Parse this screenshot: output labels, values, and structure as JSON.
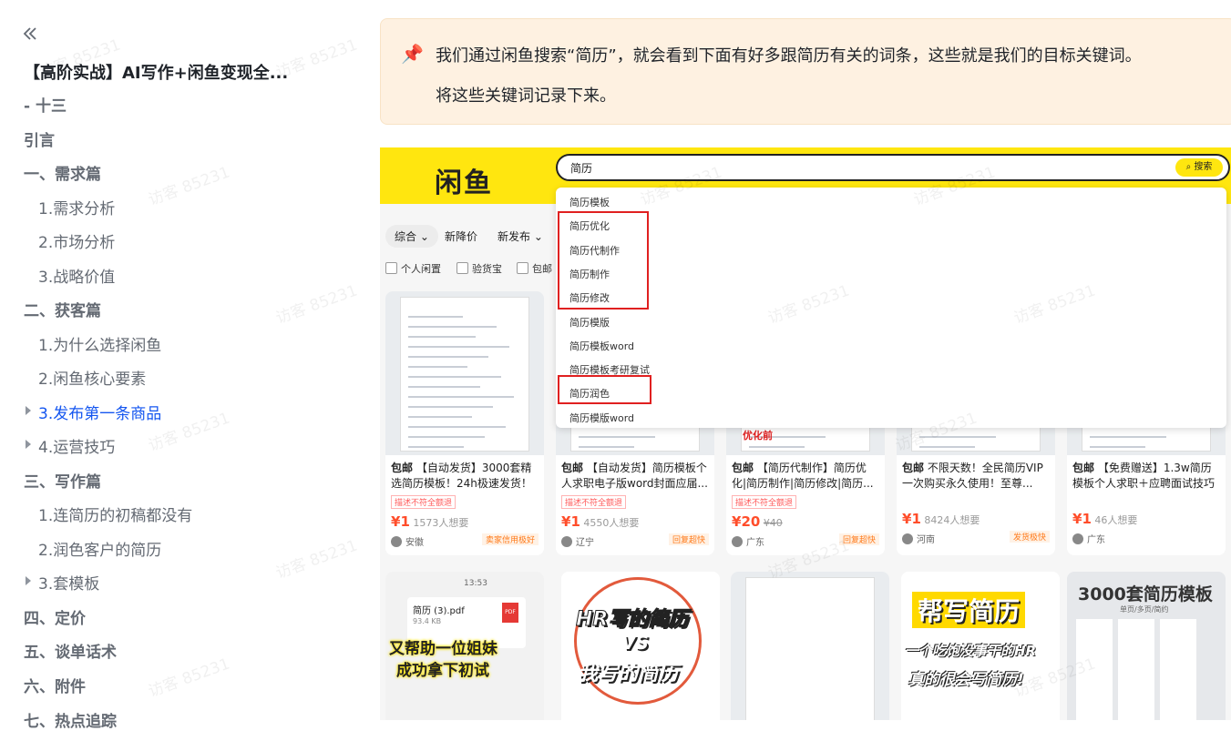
{
  "sidebar": {
    "title": "【高阶实战】AI写作+闲鱼变现全...",
    "items": [
      {
        "label": "- 十三",
        "level": "h"
      },
      {
        "label": "引言",
        "level": "h"
      },
      {
        "label": "一、需求篇",
        "level": "h"
      },
      {
        "label": "1.需求分析",
        "level": "sub"
      },
      {
        "label": "2.市场分析",
        "level": "sub"
      },
      {
        "label": "3.战略价值",
        "level": "sub"
      },
      {
        "label": "二、获客篇",
        "level": "h"
      },
      {
        "label": "1.为什么选择闲鱼",
        "level": "sub"
      },
      {
        "label": "2.闲鱼核心要素",
        "level": "sub"
      },
      {
        "label": "3.发布第一条商品",
        "level": "sub",
        "active": true,
        "caret": true
      },
      {
        "label": "4.运营技巧",
        "level": "sub",
        "caret": true
      },
      {
        "label": "三、写作篇",
        "level": "h"
      },
      {
        "label": "1.连简历的初稿都没有",
        "level": "sub"
      },
      {
        "label": "2.润色客户的简历",
        "level": "sub"
      },
      {
        "label": "3.套模板",
        "level": "sub",
        "caret": true
      },
      {
        "label": "四、定价",
        "level": "h"
      },
      {
        "label": "五、谈单话术",
        "level": "h"
      },
      {
        "label": "六、附件",
        "level": "h"
      },
      {
        "label": "七、热点追踪",
        "level": "h"
      }
    ]
  },
  "callout": {
    "icon": "pushpin-icon",
    "line1": "我们通过闲鱼搜索“简历”，就会看到下面有好多跟简历有关的词条，这些就是我们的目标关键词。",
    "line2": "将这些关键词记录下来。"
  },
  "screenshot": {
    "logo": "闲鱼",
    "search_value": "简历",
    "search_button": "搜索",
    "suggestions": [
      "简历模板",
      "简历优化",
      "简历代制作",
      "简历制作",
      "简历修改",
      "简历模版",
      "简历模板word",
      "简历模板考研复试",
      "简历润色",
      "简历模版word"
    ],
    "tabs": [
      "综合",
      "新降价",
      "新发布"
    ],
    "checks": [
      "个人闲置",
      "验货宝",
      "包邮"
    ],
    "cards": [
      {
        "tag": "包邮",
        "title": "【自动发货】3000套精选简历模板！24h极速发货！附...",
        "badge": "描述不符全额退",
        "price": "1",
        "want": "1573人想要",
        "region": "安徽",
        "seller_tag": "卖家信用极好"
      },
      {
        "tag": "包邮",
        "title": "【自动发货】简历模板个人求职电子版word封面应届...",
        "badge": "描述不符全额退",
        "price": "1",
        "want": "4550人想要",
        "region": "辽宁",
        "seller_tag": "回复超快"
      },
      {
        "tag": "包邮",
        "title": "【简历代制作】简历优化|简历制作|简历修改|简历...",
        "badge": "描述不符全额退",
        "price": "20",
        "old_price": "¥40",
        "want": "",
        "region": "广东",
        "seller_tag": "回复超快",
        "overlay": "优化前"
      },
      {
        "tag": "包邮",
        "title": "不限天数！全民简历VIP一次购买永久使用！至尊...",
        "badge": "",
        "price": "1",
        "want": "8424人想要",
        "region": "河南",
        "seller_tag": "发货极快"
      },
      {
        "tag": "包邮",
        "title": "【免费赠送】1.3w简历模板个人求职＋应聘面试技巧＋...",
        "badge": "",
        "price": "1",
        "want": "46人想要",
        "region": "广东",
        "seller_tag": ""
      }
    ],
    "row2": {
      "c1_file": "简历 (3).pdf",
      "c1_size": "93.4 KB",
      "c1_time": "13:53",
      "c1_text1": "又帮助一位姐妹",
      "c1_text2": "成功拿下初试",
      "c2_text1": "HR写的简历",
      "c2_text2": "VS",
      "c2_text3": "我写的简历",
      "c4_text1": "帮写简历",
      "c4_text2": "一个吃饱没事干的HR",
      "c4_text3": "真的很会写简历!",
      "c5_text1": "3000套简历模板",
      "c5_text2": "单页/多页/简约"
    }
  },
  "watermark": "访客 85231",
  "colors": {
    "accent": "#1456f0",
    "callout_bg": "#fef1e1",
    "xianyu_yellow": "#ffe60f",
    "red_box": "#e02020",
    "price": "#ff4d2a"
  }
}
